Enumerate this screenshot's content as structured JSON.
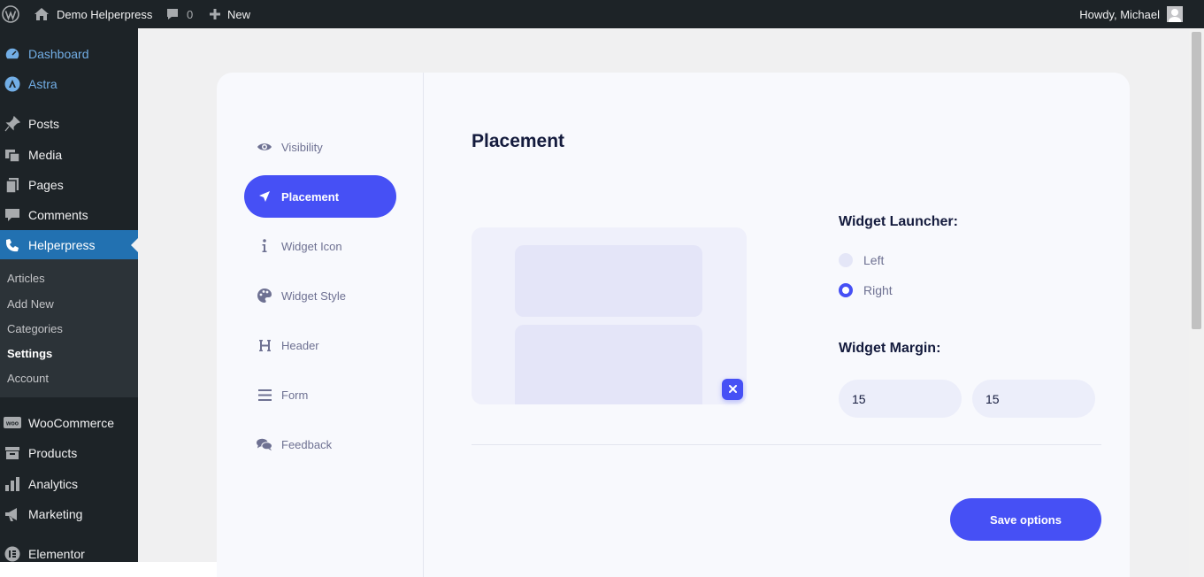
{
  "adminbar": {
    "site_name": "Demo Helperpress",
    "comments_count": "0",
    "new_label": "New",
    "howdy": "Howdy, Michael"
  },
  "sidebar": {
    "items": [
      {
        "label": "Dashboard",
        "icon": "dashboard-icon"
      },
      {
        "label": "Astra",
        "icon": "astra-icon"
      },
      {
        "label": "Posts",
        "icon": "pin-icon"
      },
      {
        "label": "Media",
        "icon": "media-icon"
      },
      {
        "label": "Pages",
        "icon": "pages-icon"
      },
      {
        "label": "Comments",
        "icon": "comment-icon"
      },
      {
        "label": "Helperpress",
        "icon": "helperpress-icon"
      },
      {
        "label": "WooCommerce",
        "icon": "woo-icon"
      },
      {
        "label": "Products",
        "icon": "archive-icon"
      },
      {
        "label": "Analytics",
        "icon": "bar-chart-icon"
      },
      {
        "label": "Marketing",
        "icon": "megaphone-icon"
      },
      {
        "label": "Elementor",
        "icon": "elementor-icon"
      }
    ],
    "submenu": [
      "Articles",
      "Add New",
      "Categories",
      "Settings",
      "Account"
    ]
  },
  "settings_nav": [
    {
      "label": "Visibility",
      "icon": "eye-icon"
    },
    {
      "label": "Placement",
      "icon": "location-arrow-icon"
    },
    {
      "label": "Widget Icon",
      "icon": "info-icon"
    },
    {
      "label": "Widget Style",
      "icon": "palette-icon"
    },
    {
      "label": "Header",
      "icon": "heading-icon"
    },
    {
      "label": "Form",
      "icon": "bars-icon"
    },
    {
      "label": "Feedback",
      "icon": "comments-icon"
    }
  ],
  "main": {
    "title": "Placement",
    "launcher_label": "Widget Launcher:",
    "launcher_options": [
      "Left",
      "Right"
    ],
    "launcher_selected": "Right",
    "margin_label": "Widget Margin:",
    "margin_x": "15",
    "margin_y": "15",
    "save_label": "Save options"
  },
  "colors": {
    "accent": "#4650f5",
    "wp_dark": "#1d2327",
    "wp_blue": "#2271b1"
  }
}
